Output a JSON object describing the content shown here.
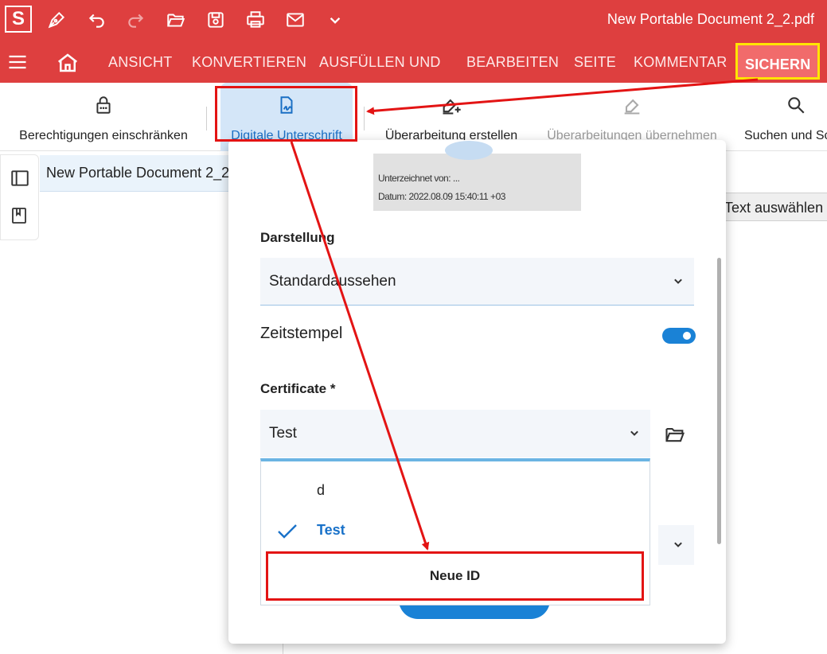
{
  "titlebar": {
    "app_logo": "S",
    "document_title": "New Portable Document 2_2.pdf"
  },
  "ribbon": {
    "tabs": [
      {
        "label": "ANSICHT"
      },
      {
        "label": "KONVERTIEREN"
      },
      {
        "label": "AUSFÜLLEN UND"
      },
      {
        "label": "BEARBEITEN"
      },
      {
        "label": "SEITE"
      },
      {
        "label": "KOMMENTAR"
      },
      {
        "label": "SICHERN",
        "active": true
      }
    ]
  },
  "toolbar": {
    "tools": [
      {
        "label": "Berechtigungen einschränken",
        "icon": "lock-icon"
      },
      {
        "label": "Digitale Unterschrift",
        "icon": "signature-icon",
        "selected": true
      },
      {
        "label": "Überarbeitung erstellen",
        "icon": "eraser-plus-icon"
      },
      {
        "label": "Überarbeitungen übernehmen",
        "icon": "eraser-icon",
        "disabled": true
      },
      {
        "label": "Suchen und Sc",
        "icon": "search-icon"
      }
    ]
  },
  "document_tab": {
    "label": "New Portable Document 2_2*"
  },
  "text_select_label": "Text auswählen",
  "signature_dialog": {
    "preview": {
      "signed_by": "Unterzeichnet von: ...",
      "date": "Datum: 2022.08.09 15:40:11 +03"
    },
    "appearance_label": "Darstellung",
    "appearance_value": "Standardaussehen",
    "timestamp_label": "Zeitstempel",
    "timestamp_on": true,
    "certificate_label": "Certificate *",
    "certificate_value": "Test",
    "certificate_options": [
      "d",
      "Test"
    ],
    "selected_option": "Test",
    "new_id_label": "Neue ID"
  },
  "colors": {
    "brand_red": "#de3f3f",
    "active_tab": "#f16b6b",
    "highlight_yellow": "#ffe500",
    "annotation_red": "#e31414",
    "accent_blue": "#1a82d6"
  }
}
